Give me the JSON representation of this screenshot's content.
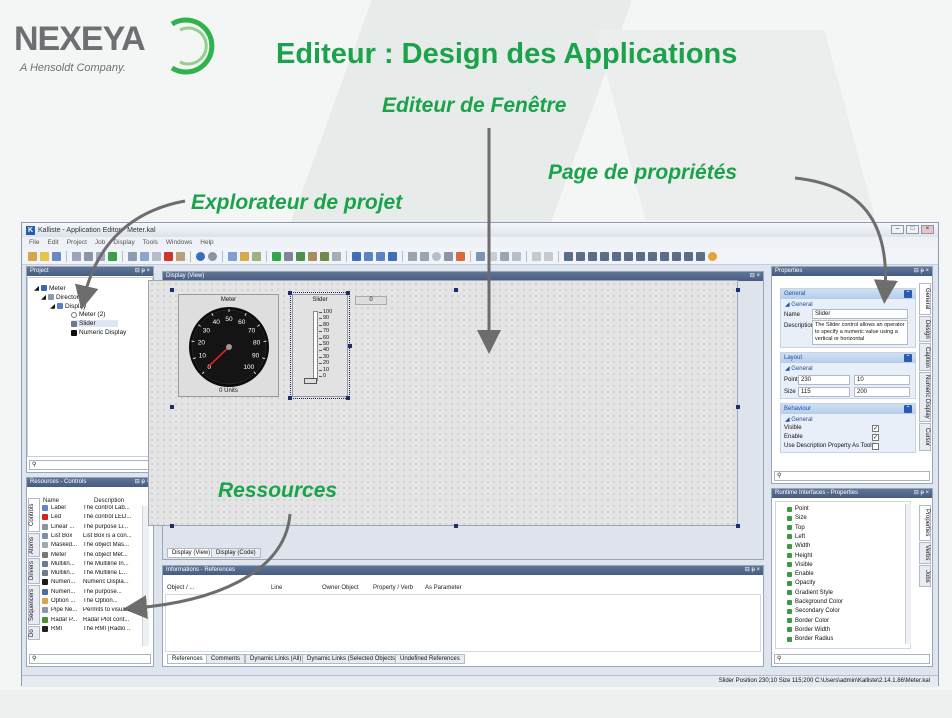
{
  "logo": {
    "word": "NEXEYA",
    "tagline": "A Hensoldt Company."
  },
  "slide_title": "Editeur : Design des Applications",
  "callouts": {
    "window_editor": "Editeur de Fenêtre",
    "properties_page": "Page de propriétés",
    "project_explorer": "Explorateur de projet",
    "resources": "Ressources"
  },
  "app": {
    "title": "Kalliste - Application Editor - Meter.kal",
    "menu": [
      "File",
      "Edit",
      "Project",
      "Job",
      "Display",
      "Tools",
      "Windows",
      "Help"
    ],
    "project_panel": {
      "title": "Project",
      "tree": [
        "Meter",
        "Directory",
        "Display",
        "Meter (2)",
        "Slider",
        "Numeric Display"
      ]
    },
    "resources_panel": {
      "title": "Resources - Controls",
      "columns": [
        "Name",
        "Description"
      ],
      "rows": [
        [
          "Label",
          "The control Lab..."
        ],
        [
          "Led",
          "The control LED..."
        ],
        [
          "Linear ...",
          "The purpose Li..."
        ],
        [
          "List Box",
          "List Box is a con..."
        ],
        [
          "Masked...",
          "The object Mas..."
        ],
        [
          "Meter",
          "The object Met..."
        ],
        [
          "Multilin...",
          "The Multiline In..."
        ],
        [
          "Multilin...",
          "The Multiline L..."
        ],
        [
          "Numeri...",
          "Numeric Displa..."
        ],
        [
          "Numeri...",
          "The purpose..."
        ],
        [
          "Option ...",
          "The Option..."
        ],
        [
          "Pipe Ne...",
          "Permits to visua..."
        ],
        [
          "Radar P...",
          "Radar Plot cont..."
        ],
        [
          "RMI",
          "The RMI (Radio ..."
        ]
      ],
      "side_tabs": [
        "Controls",
        "Atoms",
        "Drivers",
        "Sequencers",
        "Do"
      ]
    },
    "display_panel": {
      "title": "Display (View)",
      "tabs": [
        "Display (View)",
        "Display (Code)"
      ],
      "meter": {
        "label": "Meter",
        "units": "0 Units",
        "ticks": [
          "0",
          "10",
          "20",
          "30",
          "40",
          "50",
          "60",
          "70",
          "80",
          "90",
          "100"
        ]
      },
      "slider": {
        "label": "Slider",
        "ticks": [
          "100",
          "90",
          "80",
          "70",
          "60",
          "50",
          "40",
          "30",
          "20",
          "10",
          "0"
        ]
      },
      "numeric_value": "0"
    },
    "info_panel": {
      "title": "Informations - References",
      "columns": [
        "Object / ...",
        "Line",
        "Owner Object",
        "Property / Verb",
        "As Parameter"
      ],
      "tabs": [
        "References",
        "Comments",
        "Dynamic Links (All)",
        "Dynamic Links (Selected Objects)",
        "Undefined References"
      ]
    },
    "properties_panel": {
      "title": "Properties",
      "side_tabs": [
        "General",
        "Design",
        "Caption",
        "Numeric Display",
        "Cursor"
      ],
      "general": {
        "section": "General",
        "group": "General",
        "name_label": "Name",
        "name_value": "Slider",
        "description_label": "Description",
        "description_value": "The Slider control allows an operator to specify a numeric value using a vertical or horizontal"
      },
      "layout": {
        "section": "Layout",
        "group": "General",
        "point_label": "Point",
        "point_x": "230",
        "point_y": "10",
        "size_label": "Size",
        "size_w": "115",
        "size_h": "200"
      },
      "behaviour": {
        "section": "Behaviour",
        "group": "General",
        "visible_label": "Visible",
        "enable_label": "Enable",
        "tooltip_label": "Use Description Property As Tooltip"
      }
    },
    "runtime_panel": {
      "title": "Runtime Interfaces - Properties",
      "items": [
        "Point",
        "Size",
        "Top",
        "Left",
        "Width",
        "Height",
        "Visible",
        "Enable",
        "Opacity",
        "Gradient Style",
        "Background Color",
        "Secondary Color",
        "Border Color",
        "Border Width",
        "Border Radius"
      ],
      "side_tabs": [
        "Properties",
        "Verbs",
        "Jobs"
      ]
    },
    "status": "Slider  Position  230;10  Size  115;200  C:\\Users\\admin\\Kalliste\\2.14.1.86\\Meter.kal"
  }
}
